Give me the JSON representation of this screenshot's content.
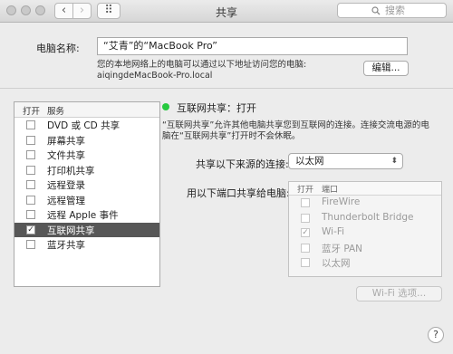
{
  "window": {
    "title": "共享",
    "search_placeholder": "搜索"
  },
  "nav": {
    "back_glyph": "‹",
    "forward_glyph": "›",
    "grid_glyph": "⠿"
  },
  "computer_name": {
    "label": "电脑名称:",
    "value": "“艾青”的“MacBook Pro”",
    "hint_line1": "您的本地网络上的电脑可以通过以下地址访问您的电脑:",
    "hint_line2": "aiqingdeMacBook-Pro.local",
    "edit_button": "编辑..."
  },
  "services": {
    "header_on": "打开",
    "header_service": "服务",
    "items": [
      {
        "label": "DVD 或 CD 共享",
        "checked": false
      },
      {
        "label": "屏幕共享",
        "checked": false
      },
      {
        "label": "文件共享",
        "checked": false
      },
      {
        "label": "打印机共享",
        "checked": false
      },
      {
        "label": "远程登录",
        "checked": false
      },
      {
        "label": "远程管理",
        "checked": false
      },
      {
        "label": "远程 Apple 事件",
        "checked": false
      },
      {
        "label": "互联网共享",
        "checked": true,
        "selected": true
      },
      {
        "label": "蓝牙共享",
        "checked": false
      }
    ]
  },
  "detail": {
    "status": "互联网共享：打开",
    "status_color": "#27c93f",
    "description": "“互联网共享”允许其他电脑共享您到互联网的连接。连接交流电源的电脑在“互联网共享”打开时不会休眠。",
    "source_label": "共享以下来源的连接:",
    "source_value": "以太网",
    "to_label": "用以下端口共享给电脑:",
    "ports_header_on": "打开",
    "ports_header_port": "端口",
    "ports": [
      {
        "label": "FireWire",
        "checked": false
      },
      {
        "label": "Thunderbolt Bridge",
        "checked": false
      },
      {
        "label": "Wi-Fi",
        "checked": true
      },
      {
        "label": "蓝牙 PAN",
        "checked": false
      },
      {
        "label": "以太网",
        "checked": false
      }
    ],
    "wifi_options_button": "Wi-Fi 选项..."
  },
  "help": {
    "glyph": "?"
  }
}
